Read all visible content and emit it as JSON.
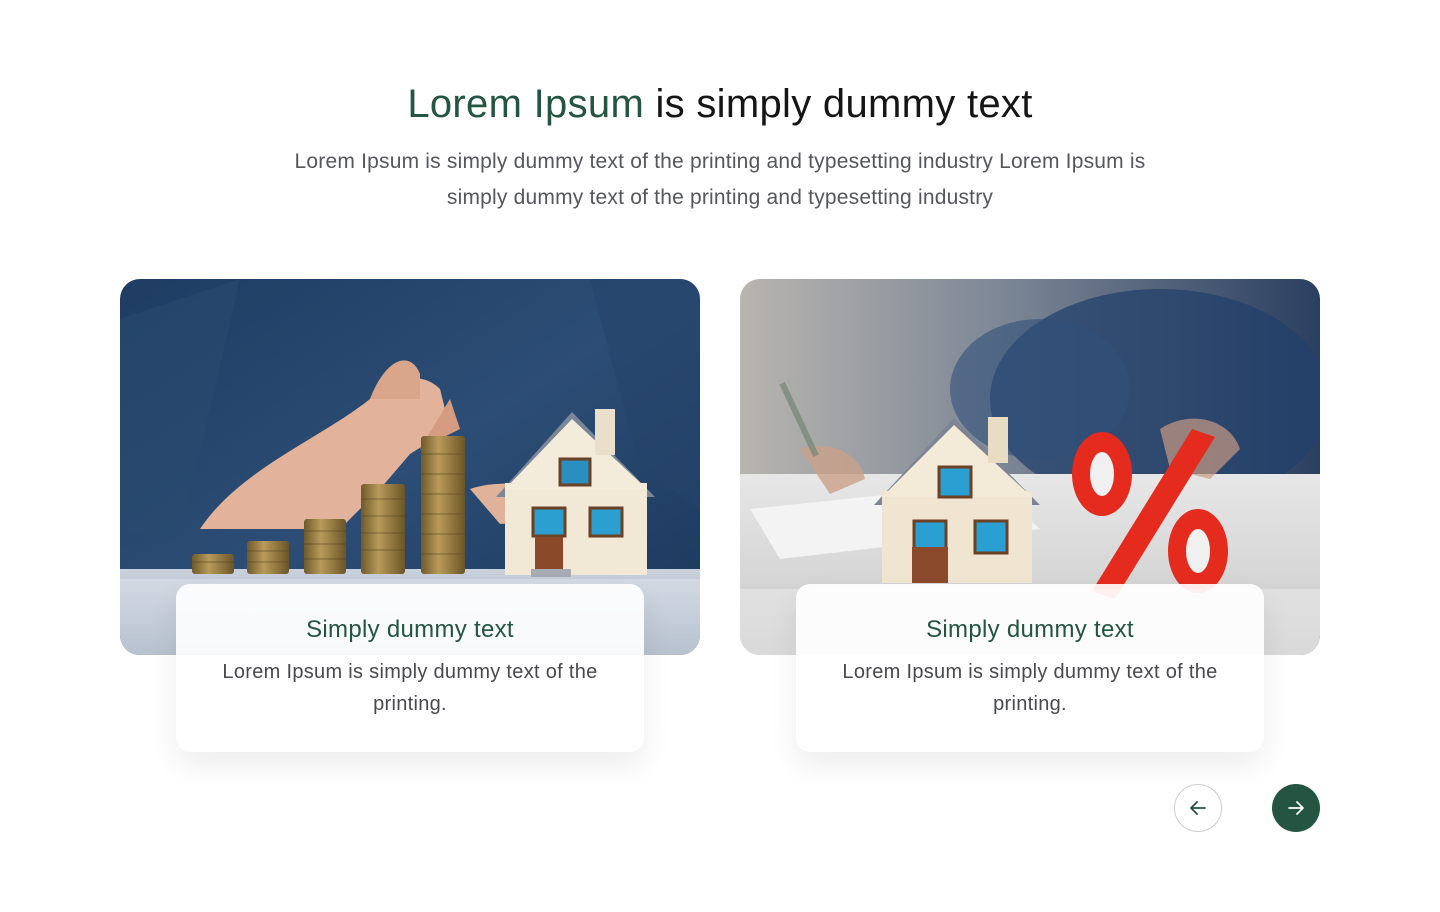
{
  "heading": {
    "accent": "Lorem Ipsum",
    "rest": " is simply dummy text"
  },
  "subtitle": "Lorem Ipsum is simply dummy text of the printing and typesetting industry Lorem Ipsum is simply dummy text of the printing and typesetting industry",
  "cards": [
    {
      "image": "coin-stacks-house-photo",
      "title": "Simply dummy text",
      "text": "Lorem Ipsum is simply dummy text of the printing."
    },
    {
      "image": "house-percent-photo",
      "title": "Simply dummy text",
      "text": "Lorem Ipsum is simply dummy text of the printing."
    }
  ],
  "controls": {
    "prev_icon": "arrow-left-icon",
    "next_icon": "arrow-right-icon"
  },
  "colors": {
    "accent": "#245442",
    "text": "#151515",
    "muted": "#55575b",
    "percent_red": "#e42b1e"
  }
}
